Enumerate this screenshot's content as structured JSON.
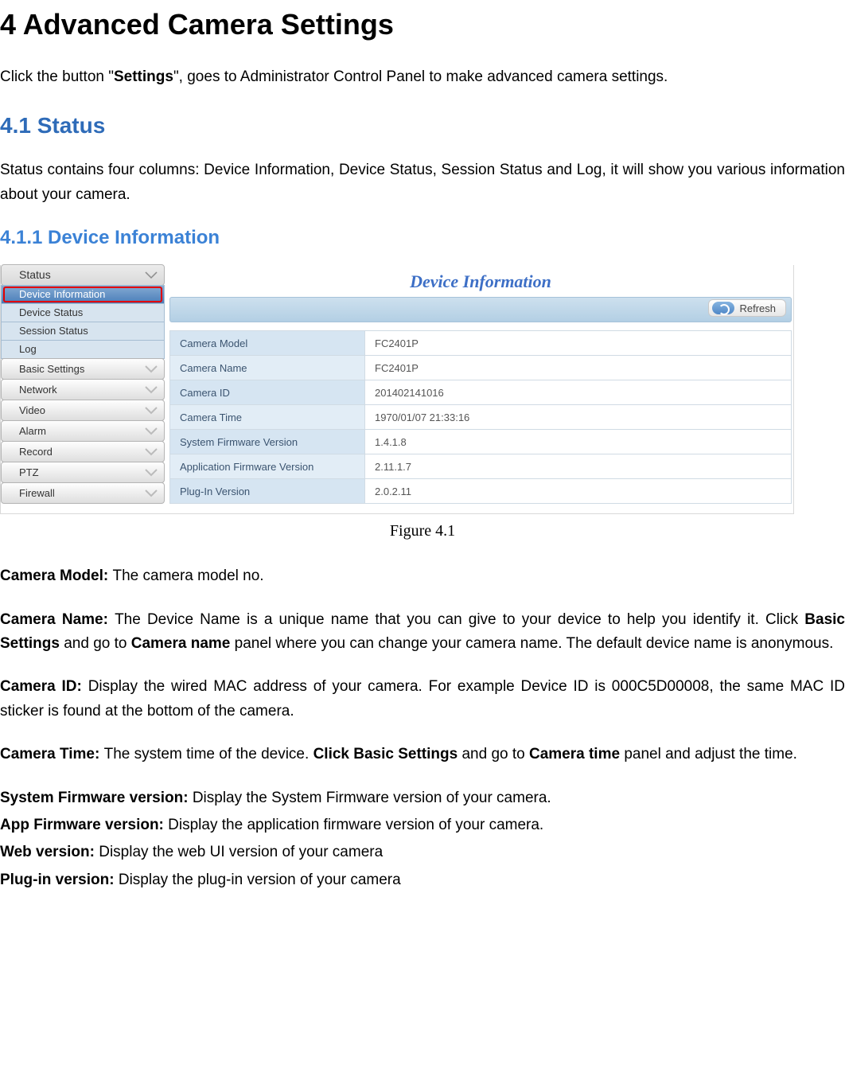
{
  "doc": {
    "h1": "4   Advanced Camera Settings",
    "intro_pre": "Click the button \"",
    "intro_bold": "Settings",
    "intro_post": "\", goes to Administrator Control Panel to make advanced camera settings.",
    "h2": "4.1   Status",
    "status_para": "Status contains four columns: Device Information, Device Status, Session Status and Log, it will show you various information about your camera.",
    "h3": "4.1.1   Device Information",
    "fig_caption": "Figure 4.1",
    "camera_model_label": "Camera Model: ",
    "camera_model_text": "The camera model no.",
    "camera_name_label": "Camera Name: ",
    "camera_name_text_1": "The Device Name is a unique name that you can give to your device to help you identify it. Click ",
    "camera_name_bold_1": "Basic Settings",
    "camera_name_text_2": " and go to ",
    "camera_name_bold_2": "Camera name",
    "camera_name_text_3": " panel where you can change your camera name. The default device name is anonymous.",
    "camera_id_label": "Camera ID: ",
    "camera_id_text": "Display the wired MAC address of your camera. For example Device ID is 000C5D00008, the same MAC ID sticker is found at the bottom of the camera.",
    "camera_time_label": "Camera Time: ",
    "camera_time_text_1": "The system time of the device. ",
    "camera_time_bold_1": "Click Basic Settings",
    "camera_time_text_2": " and go to ",
    "camera_time_bold_2": "Camera time",
    "camera_time_text_3": " panel and adjust the time.",
    "sys_fw_label": "System Firmware version: ",
    "sys_fw_text": "Display the System Firmware version of your camera.",
    "app_fw_label": "App Firmware version: ",
    "app_fw_text": "Display the application firmware version of your camera.",
    "web_label": "Web version: ",
    "web_text": "Display the web UI version of your camera",
    "plugin_label": "Plug-in version: ",
    "plugin_text": "Display the plug-in version of your camera"
  },
  "ui": {
    "panel_title": "Device Information",
    "refresh_label": "Refresh",
    "sidebar": {
      "status": "Status",
      "device_information": "Device Information",
      "device_status": "Device Status",
      "session_status": "Session Status",
      "log": "Log",
      "basic_settings": "Basic Settings",
      "network": "Network",
      "video": "Video",
      "alarm": "Alarm",
      "record": "Record",
      "ptz": "PTZ",
      "firewall": "Firewall"
    },
    "rows": [
      {
        "k": "Camera Model",
        "v": "FC2401P"
      },
      {
        "k": "Camera Name",
        "v": "FC2401P"
      },
      {
        "k": "Camera ID",
        "v": "201402141016"
      },
      {
        "k": "Camera Time",
        "v": "1970/01/07 21:33:16"
      },
      {
        "k": "System Firmware Version",
        "v": "1.4.1.8"
      },
      {
        "k": "Application Firmware Version",
        "v": "2.11.1.7"
      },
      {
        "k": "Plug-In Version",
        "v": "2.0.2.11"
      }
    ]
  }
}
